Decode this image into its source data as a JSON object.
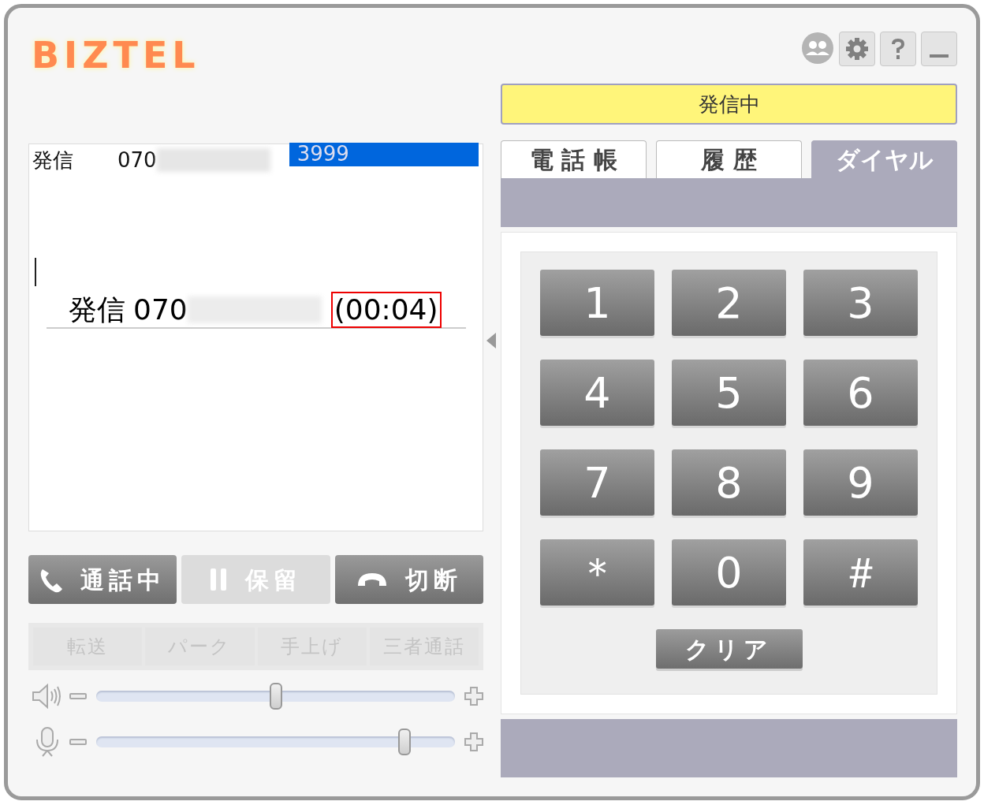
{
  "logo": "BIZTEL",
  "status": "発信中",
  "call_log": {
    "header": {
      "label": "発信",
      "number": "070",
      "extension": "3999"
    },
    "current": {
      "label": "発信",
      "number": "070",
      "duration": "(00:04)"
    }
  },
  "tabs": [
    {
      "label": "電 話 帳",
      "selected": false
    },
    {
      "label": "履 歴",
      "selected": false
    },
    {
      "label": "ダイヤル",
      "selected": true
    }
  ],
  "keypad": [
    "1",
    "2",
    "3",
    "4",
    "5",
    "6",
    "7",
    "8",
    "9",
    "＊",
    "0",
    "＃"
  ],
  "clear_button": "クリア",
  "call_buttons": [
    {
      "label": "通話中",
      "kind": "phone",
      "disabled": false
    },
    {
      "label": "保留",
      "kind": "hold",
      "disabled": true
    },
    {
      "label": "切断",
      "kind": "hangup",
      "disabled": false
    }
  ],
  "actions": [
    {
      "label": "転送",
      "disabled": true
    },
    {
      "label": "パーク",
      "disabled": true
    },
    {
      "label": "手上げ",
      "disabled": true
    },
    {
      "label": "三者通話",
      "disabled": true
    }
  ],
  "sliders": [
    {
      "kind": "speaker",
      "level": 0.5
    },
    {
      "kind": "mic",
      "level": 0.86
    }
  ]
}
